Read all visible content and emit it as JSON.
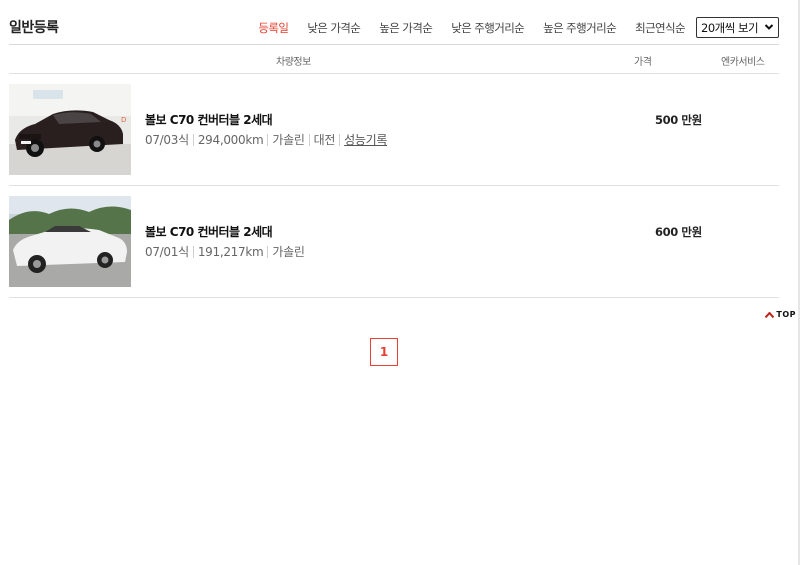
{
  "header": {
    "title": "일반등록",
    "sort_options": [
      {
        "label": "등록일",
        "active": true
      },
      {
        "label": "낮은 가격순",
        "active": false
      },
      {
        "label": "높은 가격순",
        "active": false
      },
      {
        "label": "낮은 주행거리순",
        "active": false
      },
      {
        "label": "높은 주행거리순",
        "active": false
      },
      {
        "label": "최근연식순",
        "active": false
      }
    ],
    "per_page": "20개씩 보기"
  },
  "columns": {
    "info": "차량정보",
    "price": "가격",
    "service": "엔카서비스"
  },
  "listings": [
    {
      "name": "볼보 C70 컨버터블 2세대",
      "year": "07/03식",
      "mileage": "294,000km",
      "fuel": "가솔린",
      "region": "대전",
      "record": "성능기록",
      "price": "500 만원",
      "car_color": "#2a1f1f"
    },
    {
      "name": "볼보 C70 컨버터블 2세대",
      "year": "07/01식",
      "mileage": "191,217km",
      "fuel": "가솔린",
      "price": "600 만원",
      "car_color": "#f2f2f2"
    }
  ],
  "top_button": "TOP",
  "pagination": {
    "current": "1"
  },
  "colors": {
    "accent": "#e64132"
  }
}
